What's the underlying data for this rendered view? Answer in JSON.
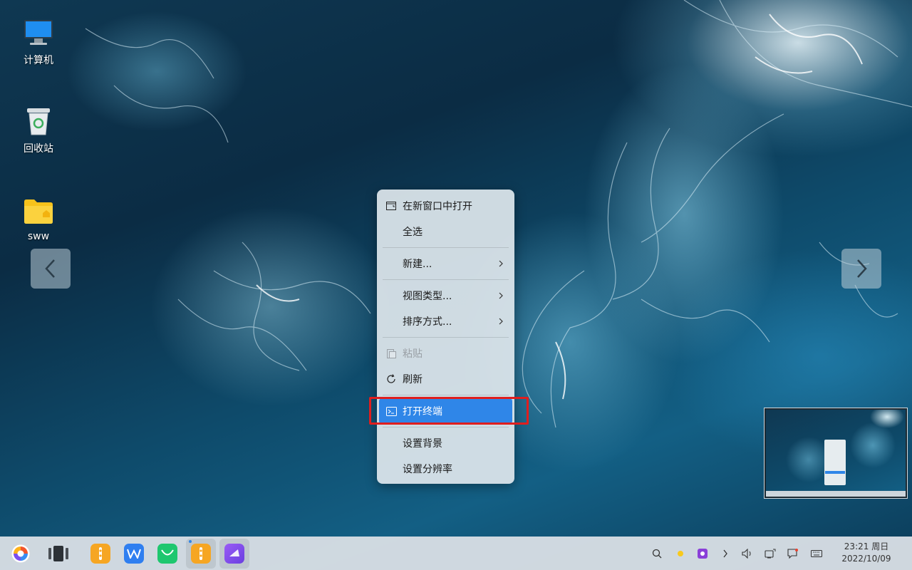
{
  "desktop": {
    "icons": [
      {
        "label": "计算机",
        "icon": "computer-icon"
      },
      {
        "label": "回收站",
        "icon": "trash-icon"
      },
      {
        "label": "sww",
        "icon": "folder-icon"
      }
    ]
  },
  "context_menu": {
    "items": [
      {
        "label": "在新窗口中打开",
        "icon": "new-window-icon",
        "state": "normal"
      },
      {
        "label": "全选",
        "state": "normal"
      },
      {
        "label": "新建...",
        "submenu": true,
        "state": "normal"
      },
      {
        "label": "视图类型...",
        "submenu": true,
        "state": "normal"
      },
      {
        "label": "排序方式...",
        "submenu": true,
        "state": "normal"
      },
      {
        "label": "粘贴",
        "icon": "paste-icon",
        "state": "disabled"
      },
      {
        "label": "刷新",
        "icon": "refresh-icon",
        "state": "normal"
      },
      {
        "label": "打开终端",
        "icon": "terminal-icon",
        "state": "highlighted"
      },
      {
        "label": "设置背景",
        "state": "normal"
      },
      {
        "label": "设置分辨率",
        "state": "normal"
      }
    ]
  },
  "taskbar": {
    "clock_time": "23:21 周日",
    "clock_date": "2022/10/09",
    "apps": [
      "start-menu-icon",
      "multitask-view-icon",
      "kylin-software-icon",
      "wps-office-icon",
      "wechat-icon",
      "kylin-software-icon",
      "screenshot-app-icon"
    ],
    "tray": [
      "search-icon",
      "sun-icon",
      "record-icon",
      "chevron-right-icon",
      "volume-icon",
      "network-icon",
      "notification-icon",
      "keyboard-icon"
    ]
  },
  "colors": {
    "highlight": "#2f86e8",
    "annotation_box": "#e01e1e"
  }
}
